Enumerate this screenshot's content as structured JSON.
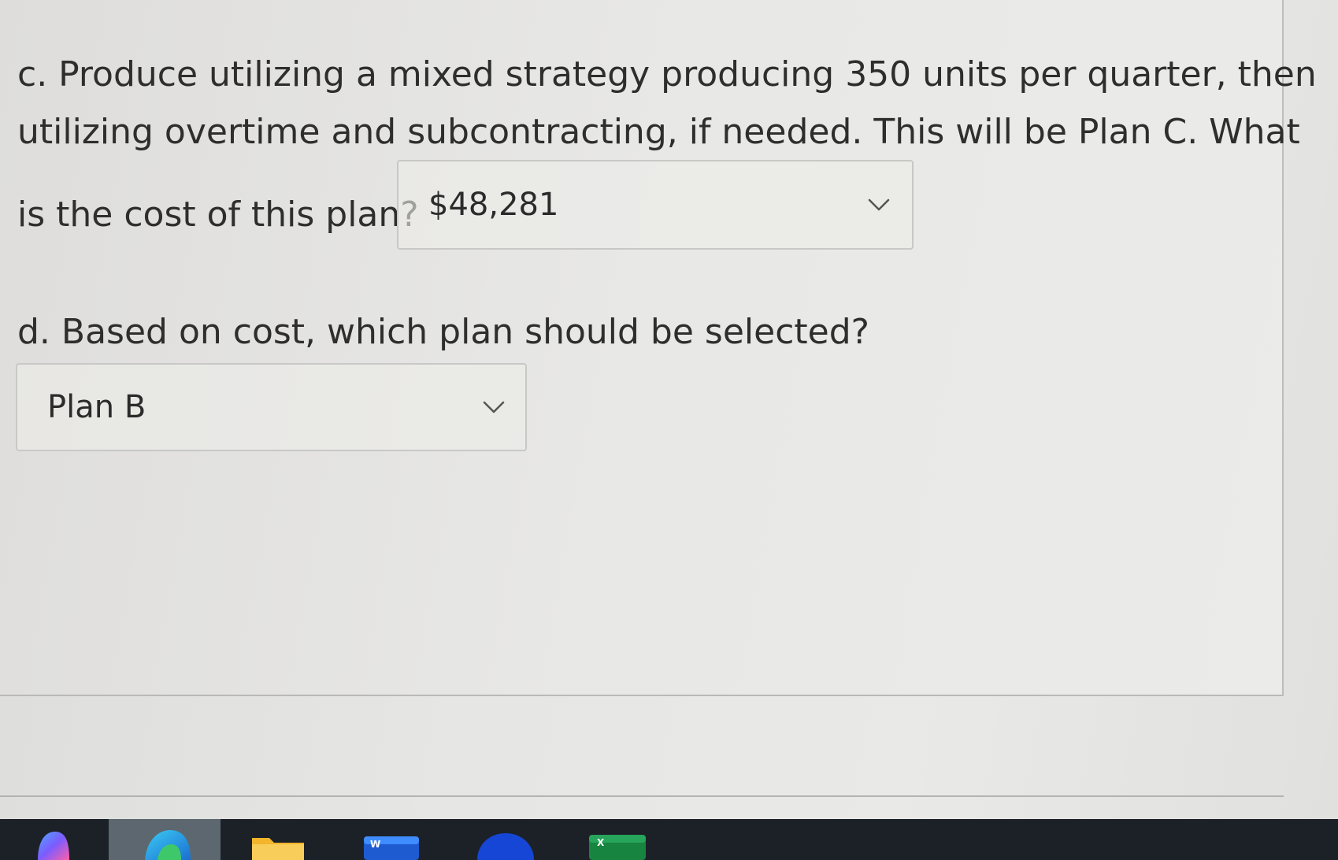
{
  "question_c": {
    "line1": "c. Produce utilizing a mixed strategy producing 350 units per quarter, then",
    "line2": "utilizing overtime and subcontracting, if needed. This will be Plan C. What",
    "line3": "is the cost of this plan?",
    "answer_value": "$48,281"
  },
  "question_d": {
    "line1": "d. Based on cost, which plan should be selected?",
    "answer_value": "Plan B"
  },
  "icons": {
    "dropdown": "chevron-down-icon",
    "taskbar": [
      "copilot-icon",
      "edge-icon",
      "file-explorer-icon",
      "word-icon",
      "app-icon",
      "excel-icon"
    ]
  },
  "colors": {
    "page_bg": "#e6e6e4",
    "text": "#2e2e2e",
    "border": "#c8c8c6",
    "taskbar": "#1c2128"
  }
}
